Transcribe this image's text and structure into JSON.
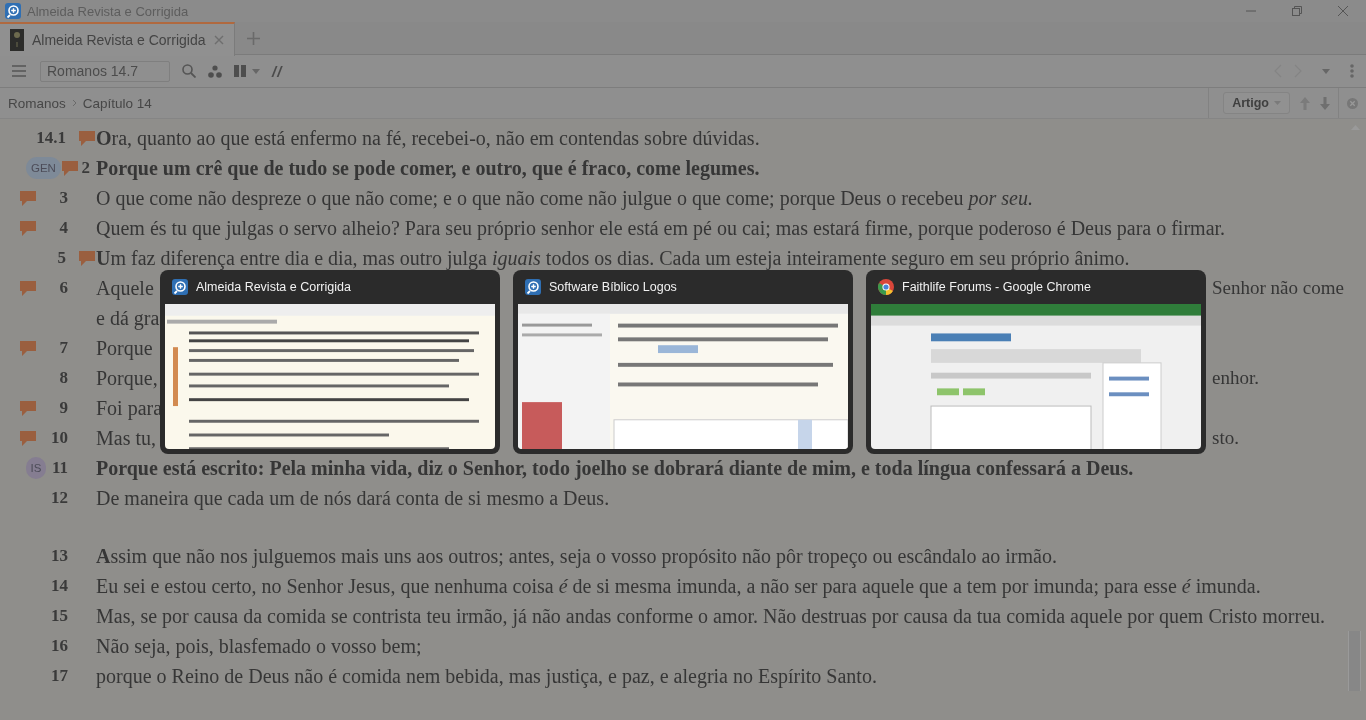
{
  "window": {
    "title": "Almeida Revista e Corrigida"
  },
  "tabs": [
    {
      "label": "Almeida Revista e Corrigida",
      "selected": true
    }
  ],
  "toolbar": {
    "reference": "Romanos 14.7",
    "parallel_label": "//"
  },
  "breadcrumb": [
    "Romanos",
    "Capítulo 14"
  ],
  "view_menu": "Artigo",
  "verses": [
    {
      "kind": "full",
      "number": "14.1",
      "note": {
        "kind": "after_number"
      },
      "text": "**O**ra, quanto ao que está enfermo na fé, recebei-o, não em contendas sobre dúvidas."
    },
    {
      "kind": "full",
      "number": "2",
      "note": {
        "kind": "before_number"
      },
      "badge": "GEN",
      "color": "#7e8a98",
      "bold": true,
      "text": "Porque um crê que de tudo se pode comer, e outro, que é fraco, come legumes."
    },
    {
      "kind": "full",
      "number": "3",
      "note": {
        "kind": "margin"
      },
      "text": "O que come não despreze o que não come; e o que não come não julgue o que come; porque Deus o recebeu *por seu.*"
    },
    {
      "kind": "full",
      "number": "4",
      "note": {
        "kind": "margin"
      },
      "text": "Quem és tu que julgas o servo alheio? Para seu próprio senhor ele está em pé ou cai; mas estará firme, porque poderoso é Deus para o firmar."
    },
    {
      "kind": "full",
      "number": "5",
      "note": {
        "kind": "after_number"
      },
      "text": "**U**m faz diferença entre dia e dia, mas outro julga *iguais* todos os dias. Cada um esteja inteiramente seguro em seu próprio ânimo."
    },
    {
      "kind": "covered",
      "number": "6",
      "note": {
        "kind": "margin"
      },
      "lines": [
        {
          "start": "Aquele",
          "end": "Senhor não come"
        },
        {
          "start": "e dá gra"
        }
      ]
    },
    {
      "kind": "covered",
      "number": "7",
      "note": {
        "kind": "margin"
      },
      "lines": [
        {
          "start": "Porque"
        }
      ]
    },
    {
      "kind": "covered",
      "number": "8",
      "lines": [
        {
          "start": "Porque,",
          "end": "enhor."
        }
      ]
    },
    {
      "kind": "covered",
      "number": "9",
      "note": {
        "kind": "margin"
      },
      "lines": [
        {
          "start": "Foi para"
        }
      ]
    },
    {
      "kind": "covered",
      "number": "10",
      "note": {
        "kind": "margin"
      },
      "lines": [
        {
          "start": "Mas tu,",
          "end": "sto."
        }
      ]
    },
    {
      "kind": "full",
      "number": "11",
      "badge": "IS",
      "color": "#857d91",
      "bold": true,
      "text": "Porque está escrito: Pela minha vida, diz o Senhor, todo joelho se dobrará diante de mim, e toda língua confessará a Deus."
    },
    {
      "kind": "full",
      "number": "12",
      "text": "De maneira que cada um de nós dará conta de si mesmo a Deus."
    },
    {
      "kind": "full",
      "number": "13",
      "paragraph_start": true,
      "text": "**A**ssim que não nos julguemos mais uns aos outros; antes, seja o vosso propósito não pôr tropeço ou escândalo ao irmão."
    },
    {
      "kind": "full",
      "number": "14",
      "text": "Eu sei e estou certo, no Senhor Jesus, que nenhuma coisa *é* de si mesma imunda, a não ser para aquele que a tem por imunda; para esse *é* imunda."
    },
    {
      "kind": "full",
      "number": "15",
      "text": "Mas, se por causa da comida se contrista teu irmão, já não andas conforme o amor. Não destruas por causa da tua comida aquele por quem Cristo morreu."
    },
    {
      "kind": "full",
      "number": "16",
      "text": "Não seja, pois, blasfemado o vosso bem;"
    },
    {
      "kind": "full",
      "number": "17",
      "text": "porque o Reino de Deus não é comida nem bebida, mas justiça, e paz, e alegria no Espírito Santo."
    }
  ],
  "taskbar_previews": [
    {
      "kind": "logos",
      "title": "Almeida Revista e Corrigida"
    },
    {
      "kind": "logos",
      "title": "Software Bíblico Logos"
    },
    {
      "kind": "chrome",
      "title": "Faithlife Forums - Google Chrome"
    }
  ]
}
